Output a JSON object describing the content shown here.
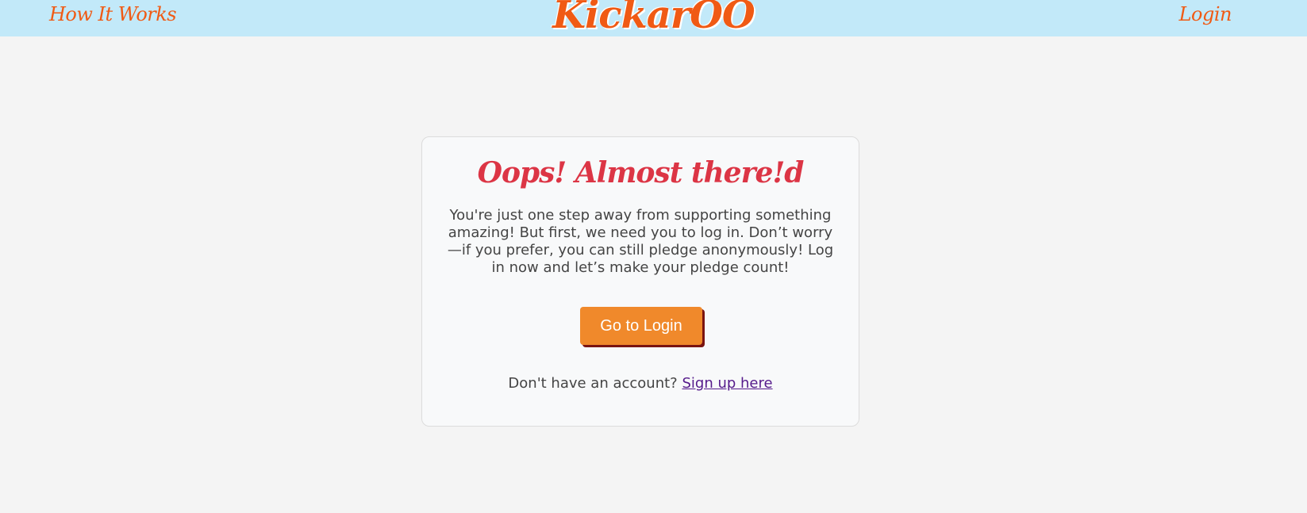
{
  "nav": {
    "left_link": "How It Works",
    "brand": "KickarOO",
    "right_link": "Login"
  },
  "card": {
    "title": "Oops! Almost there!d",
    "message": "You're just one step away from supporting something amazing! But first, we need you to log in. Don’t worry—if you prefer, you can still pledge anonymously! Log in now and let’s make your pledge count!",
    "button_label": "Go to Login",
    "signup_prompt": "Don't have an account?",
    "signup_link": "Sign up here"
  },
  "colors": {
    "navbar_bg": "#c2e9f9",
    "brand_orange": "#f05a14",
    "title_red": "#dc3545",
    "button_orange": "#f0892b",
    "link_purple": "#551a8b"
  }
}
